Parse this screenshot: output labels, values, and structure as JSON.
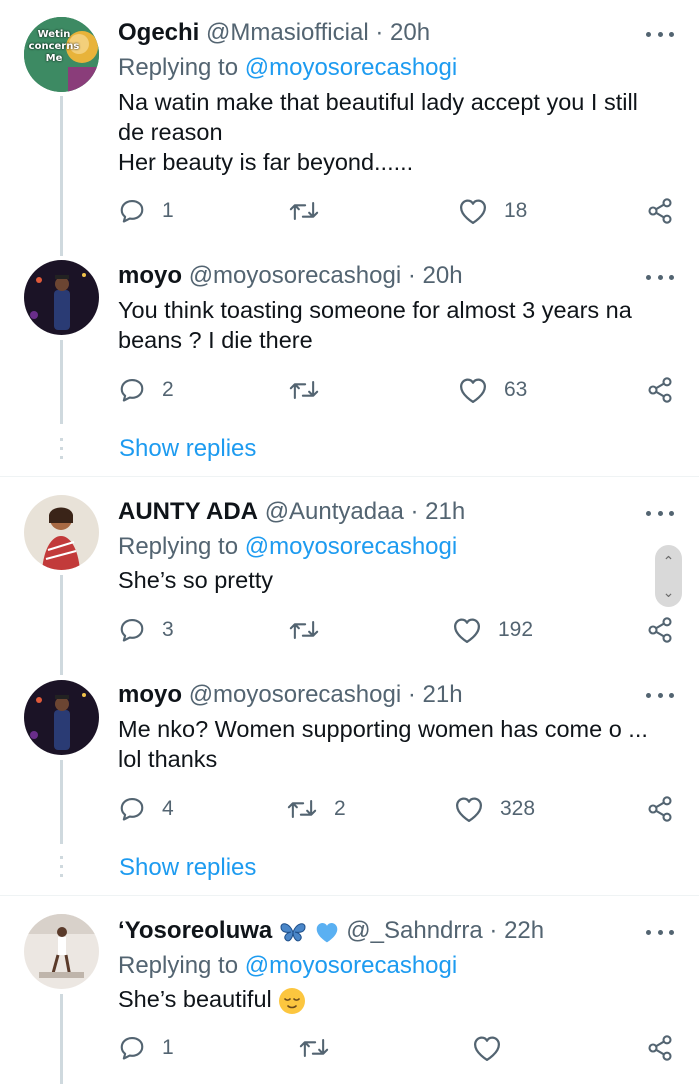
{
  "tweets": [
    {
      "name": "Ogechi",
      "handle": "@Mmasiofficial",
      "time": "20h",
      "replying_prefix": "Replying to ",
      "replying_to": "@moyosorecashogi",
      "lines": [
        "Na watin make that beautiful lady accept you I still",
        "de reason",
        "Her beauty is far beyond......"
      ],
      "replies": "1",
      "retweets": "",
      "likes": "18",
      "avatar_text": [
        "Wetin",
        "concerns",
        "Me"
      ]
    },
    {
      "name": "moyo",
      "handle": "@moyosorecashogi",
      "time": "20h",
      "lines": [
        "You think toasting someone for almost 3 years na",
        "beans ? I die there"
      ],
      "replies": "2",
      "retweets": "",
      "likes": "63",
      "show_replies": "Show replies"
    },
    {
      "name": "AUNTY ADA",
      "handle": "@Auntyadaa",
      "time": "21h",
      "replying_prefix": "Replying to ",
      "replying_to": "@moyosorecashogi",
      "lines": [
        "She’s so pretty"
      ],
      "replies": "3",
      "retweets": "",
      "likes": "192"
    },
    {
      "name": "moyo",
      "handle": "@moyosorecashogi",
      "time": "21h",
      "lines": [
        "Me nko? Women supporting women has come o ...",
        "lol thanks"
      ],
      "replies": "4",
      "retweets": "2",
      "likes": "328",
      "show_replies": "Show replies"
    },
    {
      "name": "‘Yosoreoluwa",
      "name_emojis": [
        "butterfly",
        "blue-heart"
      ],
      "handle": "@_Sahndrra",
      "time": "22h",
      "replying_prefix": "Replying to ",
      "replying_to": "@moyosorecashogi",
      "lines": [
        "She’s beautiful"
      ],
      "line_emoji": "relieved-face",
      "replies": "1",
      "retweets": "",
      "likes": ""
    }
  ],
  "separator_dot": "·",
  "icons": {
    "reply": "reply-icon",
    "retweet": "retweet-icon",
    "like": "like-icon",
    "share": "share-icon",
    "more": "more-icon",
    "scroll_up": "scroll-up-icon",
    "scroll_down": "scroll-down-icon"
  },
  "colors": {
    "accent": "#1d9bf0",
    "muted": "#536471",
    "text": "#0f1419",
    "line": "#cfd9de"
  }
}
